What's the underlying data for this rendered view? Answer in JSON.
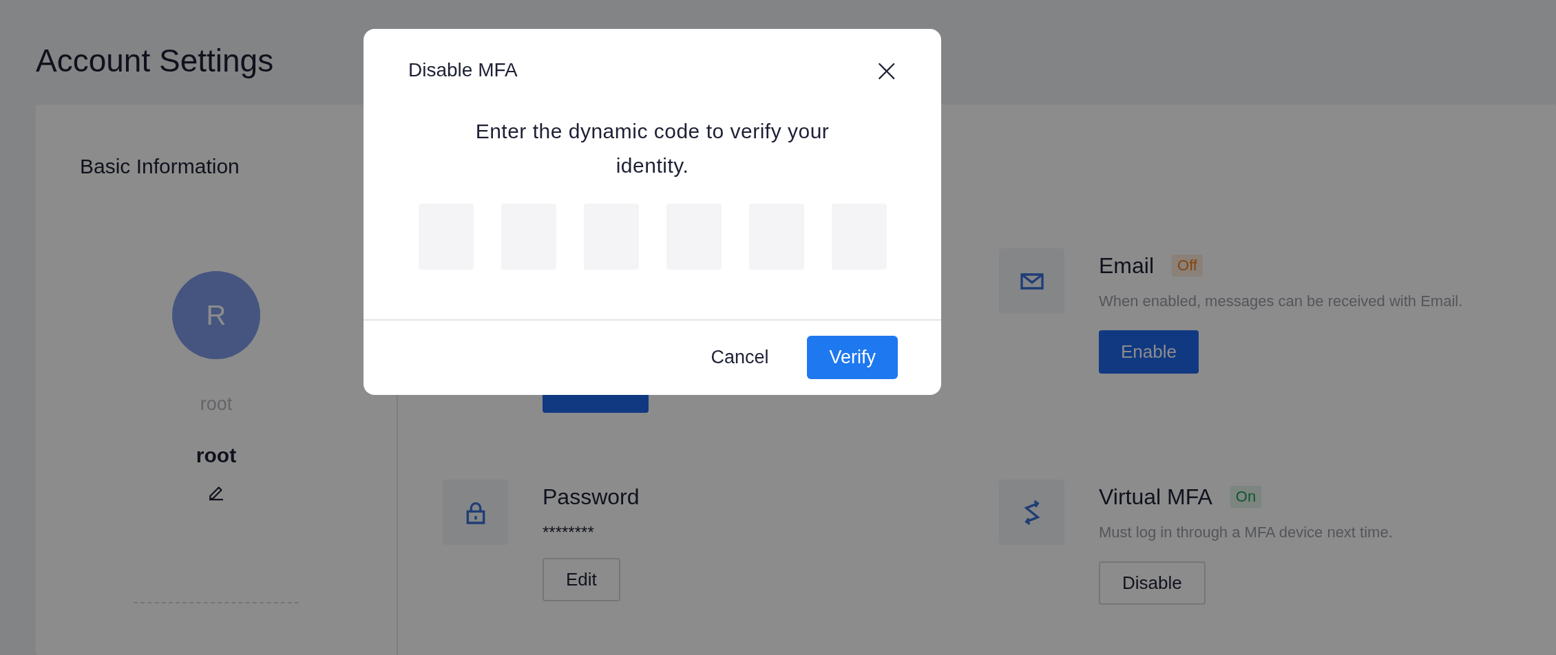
{
  "page": {
    "title": "Account Settings"
  },
  "basic_info": {
    "heading": "Basic Information",
    "avatar_letter": "R",
    "username": "root",
    "display_name": "root"
  },
  "security_items": [
    {
      "button": {
        "kind": "primary"
      }
    },
    {
      "kind": "mail",
      "title": "Email",
      "status": {
        "label": "Off",
        "enabled": false
      },
      "description": "When enabled, messages can be received with Email.",
      "button": {
        "label": "Enable",
        "kind": "primary"
      }
    },
    {
      "kind": "lock",
      "title": "Password",
      "value": "********",
      "button": {
        "label": "Edit",
        "kind": "default"
      }
    },
    {
      "kind": "mfa",
      "title": "Virtual MFA",
      "status": {
        "label": "On",
        "enabled": true
      },
      "description": "Must log in through a MFA device next time.",
      "button": {
        "label": "Disable",
        "kind": "default"
      }
    }
  ],
  "dialog": {
    "title": "Disable MFA",
    "close": "×",
    "message": "Enter the dynamic code to verify your identity.",
    "buttons": [
      {
        "label": "Cancel",
        "kind": "text"
      },
      {
        "label": "Verify",
        "kind": "primary"
      }
    ]
  }
}
